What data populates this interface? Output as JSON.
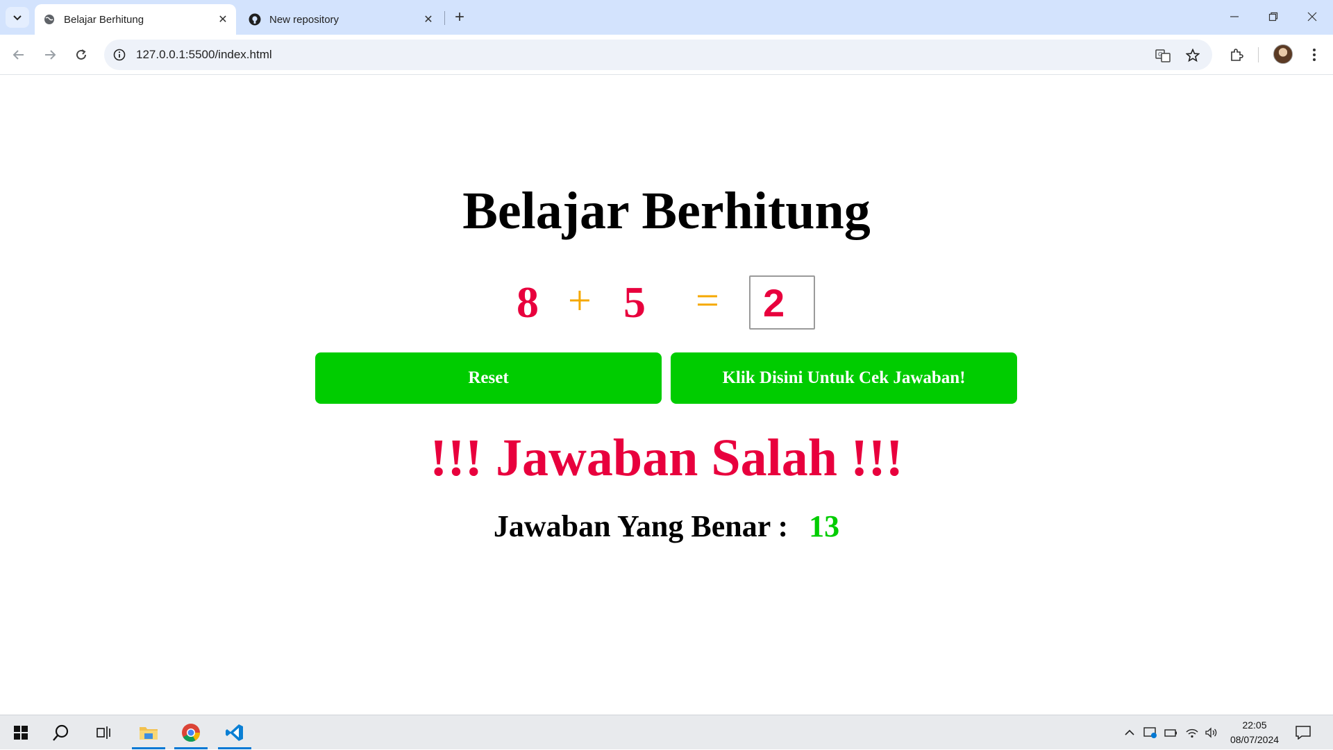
{
  "browser": {
    "tabs": [
      {
        "title": "Belajar Berhitung",
        "icon": "globe-icon",
        "active": true
      },
      {
        "title": "New repository",
        "icon": "github-icon",
        "active": false
      }
    ],
    "url": "127.0.0.1:5500/index.html"
  },
  "page": {
    "title": "Belajar Berhitung",
    "equation": {
      "operand1": "8",
      "operator": "+",
      "operand2": "5",
      "equals": "=",
      "answer_value": "2"
    },
    "buttons": {
      "reset_label": "Reset",
      "check_label": "Klik Disini Untuk Cek Jawaban!"
    },
    "result_message": "!!! Jawaban Salah !!!",
    "correct_label": "Jawaban Yang Benar :",
    "correct_value": "13"
  },
  "taskbar": {
    "time": "22:05",
    "date": "08/07/2024"
  },
  "colors": {
    "number": "#e8003d",
    "operator": "#f5a800",
    "button": "#00cc00",
    "correct_value": "#00cc00"
  }
}
